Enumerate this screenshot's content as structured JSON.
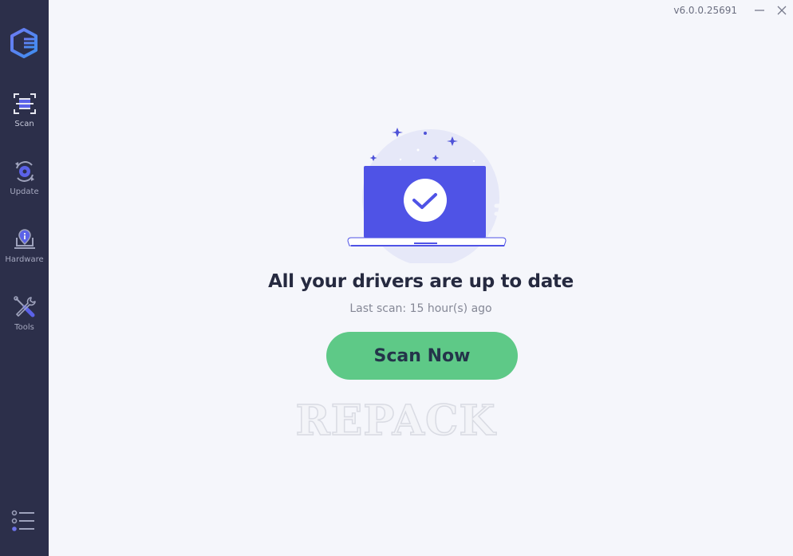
{
  "app": {
    "version": "v6.0.0.25691",
    "brand_color": "#4f5de8",
    "sidebar_color": "#2c2f4a",
    "background_color": "#f5f6fb"
  },
  "window_controls": {
    "minimize_icon": "minimize-icon",
    "close_icon": "close-icon"
  },
  "sidebar": {
    "logo_icon": "driver-booster-logo-icon",
    "items": [
      {
        "label": "Scan",
        "icon": "scan-icon",
        "active": true
      },
      {
        "label": "Update",
        "icon": "update-icon",
        "active": false
      },
      {
        "label": "Hardware",
        "icon": "hardware-icon",
        "active": false
      },
      {
        "label": "Tools",
        "icon": "tools-icon",
        "active": false
      }
    ],
    "menu_icon": "menu-list-icon"
  },
  "main": {
    "illustration_icon": "laptop-checkmark-icon",
    "headline": "All your drivers are up to date",
    "last_scan": "Last scan: 15 hour(s) ago",
    "scan_button": {
      "label": "Scan Now",
      "color": "#5ec987"
    },
    "watermark": "REPACK"
  }
}
